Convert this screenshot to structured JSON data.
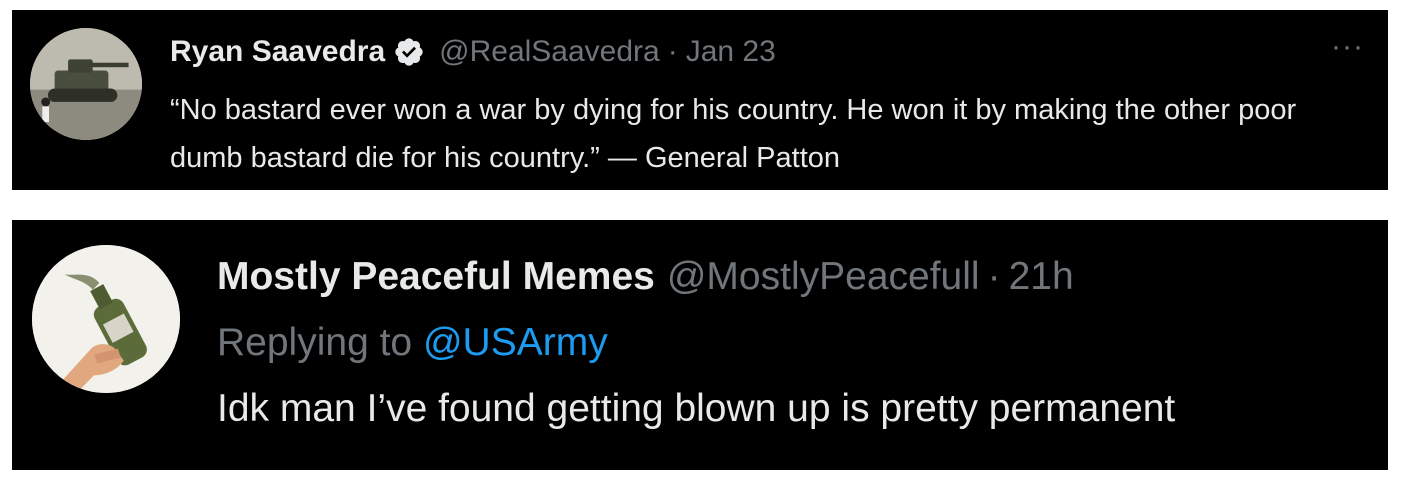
{
  "tweets": [
    {
      "author_name": "Ryan Saavedra",
      "verified": true,
      "handle": "@RealSaavedra",
      "separator": "·",
      "time": "Jan 23",
      "more_label": "···",
      "text": "“No bastard ever won a war by dying for his country. He won it by making the other poor dumb bastard die for his country.” — General Patton",
      "avatar_icon": "tank-avatar-icon"
    },
    {
      "author_name": "Mostly Peaceful Memes",
      "handle": "@MostlyPeacefull",
      "separator": "·",
      "time": "21h",
      "replying_label": "Replying to",
      "replying_to": "@USArmy",
      "text": "Idk man I’ve found getting blown up is pretty permanent",
      "avatar_icon": "molotov-bottle-avatar-icon"
    }
  ],
  "colors": {
    "background": "#000000",
    "text": "#e7e9ea",
    "muted": "#71767b",
    "link": "#1d9bf0",
    "verified_badge": "#e7e9ea"
  }
}
